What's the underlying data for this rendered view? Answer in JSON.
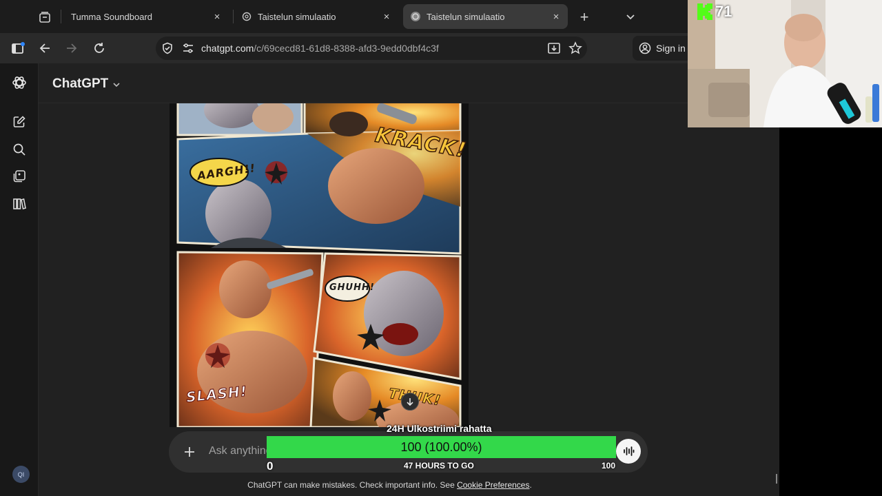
{
  "browser": {
    "tabs": [
      {
        "title": "Tumma Soundboard",
        "close": "×",
        "active": false
      },
      {
        "title": "Taistelun simulaatio",
        "close": "×",
        "active": false
      },
      {
        "title": "Taistelun simulaatio",
        "close": "×",
        "active": true
      }
    ],
    "new_tab": "+",
    "address": {
      "host": "chatgpt.com",
      "path": "/c/69cecd81-61d8-8388-afd3-9edd0dbf4c3f"
    },
    "sign_in_label": "Sign in"
  },
  "app": {
    "model_name": "ChatGPT",
    "avatar_initials": "QI",
    "composer_placeholder": "Ask anything",
    "disclaimer_text": "ChatGPT can make mistakes. Check important info. See ",
    "disclaimer_link": "Cookie Preferences",
    "disclaimer_end": "."
  },
  "comic": {
    "sfx": [
      "KRACK!",
      "AARGH!!",
      "GHUHH!",
      "SLASH!",
      "THUK!"
    ]
  },
  "overlay": {
    "goal_title": "24H Ulkostriimi rahatta",
    "goal_value_text": "100 (100.00%)",
    "goal_fraction": 1.0,
    "goal_min": "0",
    "goal_max": "100",
    "goal_remaining": "47 HOURS TO GO",
    "viewer_count": "71",
    "colors": {
      "goal_fill": "#33d84a",
      "kick_green": "#53fc18"
    }
  }
}
